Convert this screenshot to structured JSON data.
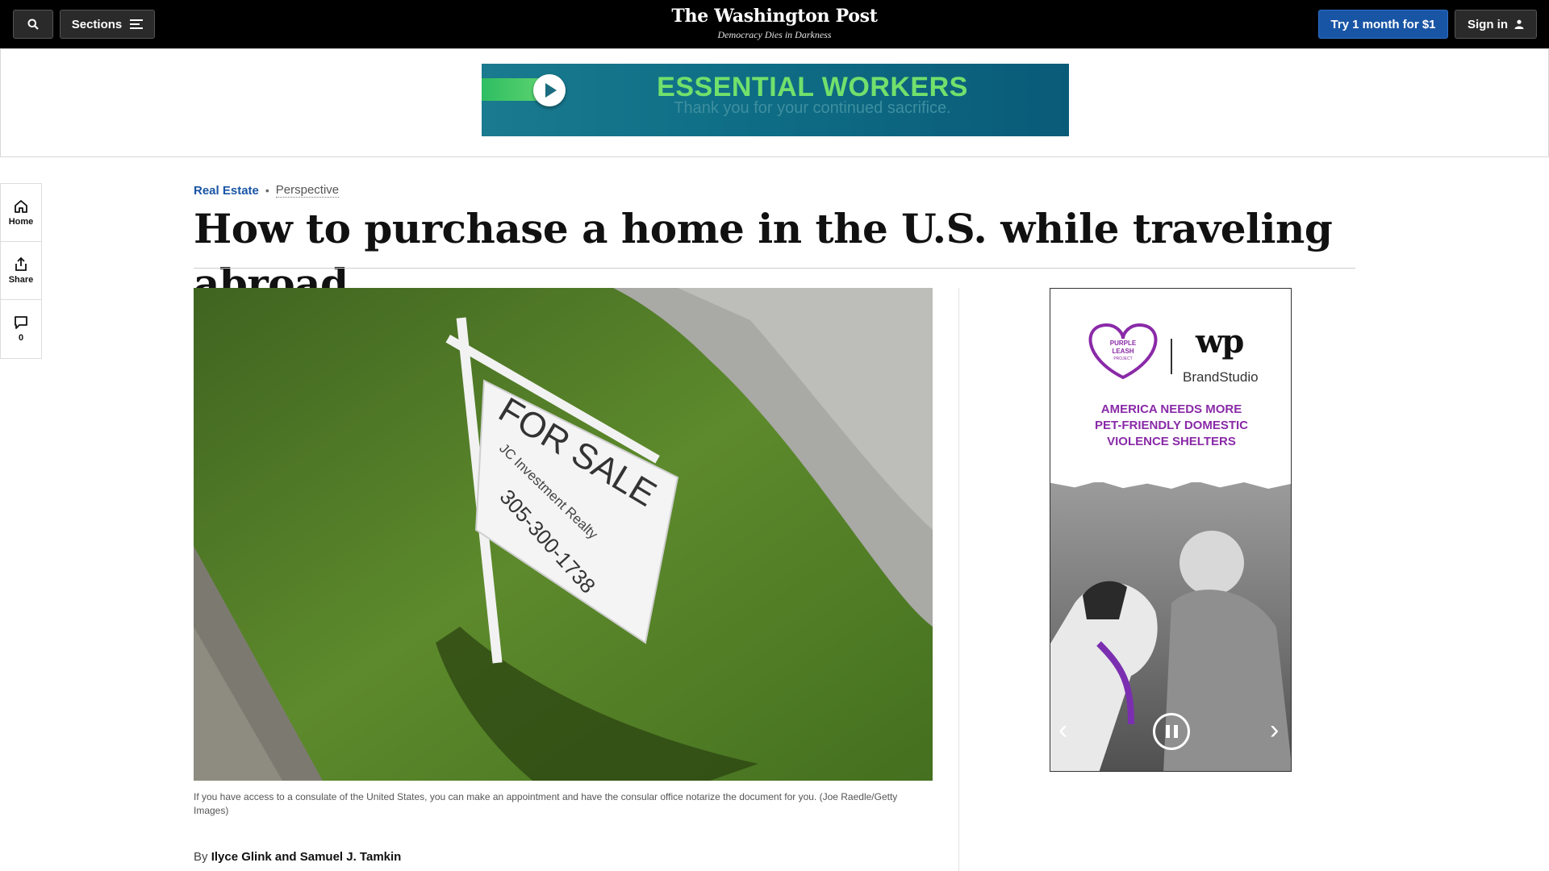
{
  "header": {
    "sections_label": "Sections",
    "logo_text": "The Washington Post",
    "tagline": "Democracy Dies in Darkness",
    "subscribe_label": "Try 1 month for $1",
    "signin_label": "Sign in"
  },
  "top_ad": {
    "headline": "ESSENTIAL WORKERS",
    "subline": "Thank you for your continued sacrifice."
  },
  "rail": {
    "home_label": "Home",
    "share_label": "Share",
    "comments_count": "0"
  },
  "article": {
    "section": "Real Estate",
    "label": "Perspective",
    "headline": "How to purchase a home in the U.S. while traveling abroad",
    "caption": "If you have access to a consulate of the United States, you can make an appointment and have the consular office notarize the document for you. (Joe Raedle/Getty Images)",
    "byline_prefix": "By",
    "authors": "Ilyce Glink and Samuel J. Tamkin",
    "photo_sign": {
      "line1": "FOR SALE",
      "line2": "JC Investment Realty",
      "line3": "305-300-1738"
    }
  },
  "side_ad": {
    "partner_logo_text": "PURPLE LEASH PROJECT",
    "wp_logo": "wp",
    "brand_studio": "BrandStudio",
    "message_lines": [
      "AMERICA NEEDS MORE",
      "PET-FRIENDLY DOMESTIC",
      "VIOLENCE SHELTERS"
    ]
  },
  "colors": {
    "header_bg": "#000000",
    "accent_blue": "#1955a5",
    "ad_purple": "#8a2aa8"
  }
}
